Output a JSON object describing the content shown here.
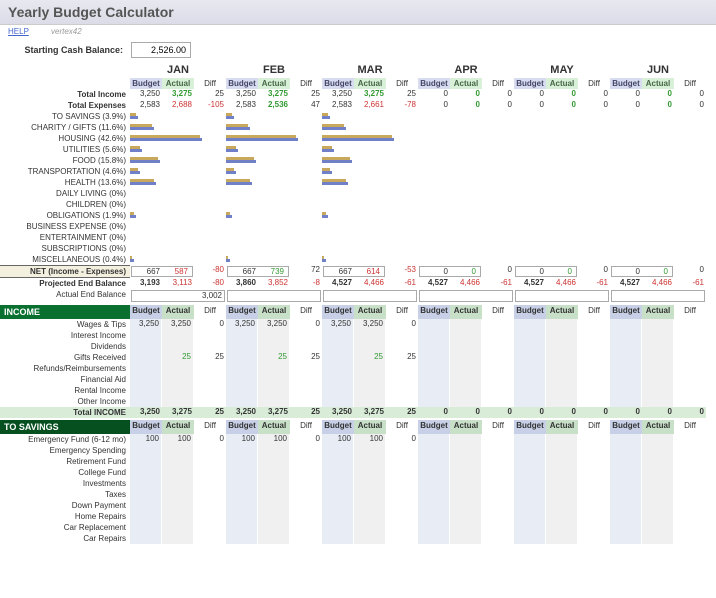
{
  "title": "Yearly Budget Calculator",
  "help": "HELP",
  "brand": "vertex42",
  "start_label": "Starting Cash Balance:",
  "start_value": "2,526.00",
  "months": [
    "JAN",
    "FEB",
    "MAR",
    "APR",
    "MAY",
    "JUN"
  ],
  "subheaders": {
    "budget": "Budget",
    "actual": "Actual",
    "diff": "Diff"
  },
  "summary": {
    "total_income": {
      "label": "Total Income",
      "vals": [
        [
          "3,250",
          "3,275",
          "25"
        ],
        [
          "3,250",
          "3,275",
          "25"
        ],
        [
          "3,250",
          "3,275",
          "25"
        ],
        [
          "0",
          "0",
          "0"
        ],
        [
          "0",
          "0",
          "0"
        ],
        [
          "0",
          "0",
          "0"
        ]
      ]
    },
    "total_expenses": {
      "label": "Total Expenses",
      "vals": [
        [
          "2,583",
          "2,688",
          "-105"
        ],
        [
          "2,583",
          "2,536",
          "47"
        ],
        [
          "2,583",
          "2,661",
          "-78"
        ],
        [
          "0",
          "0",
          "0"
        ],
        [
          "0",
          "0",
          "0"
        ],
        [
          "0",
          "0",
          "0"
        ]
      ]
    }
  },
  "categories": [
    {
      "label": "TO SAVINGS (3.9%)",
      "b": [
        6,
        6,
        6,
        0,
        0,
        0
      ]
    },
    {
      "label": "CHARITY / GIFTS (11.6%)",
      "b": [
        22,
        22,
        22,
        0,
        0,
        0
      ]
    },
    {
      "label": "HOUSING (42.6%)",
      "b": [
        70,
        70,
        70,
        0,
        0,
        0
      ]
    },
    {
      "label": "UTILITIES (5.6%)",
      "b": [
        10,
        10,
        10,
        0,
        0,
        0
      ]
    },
    {
      "label": "FOOD (15.8%)",
      "b": [
        28,
        28,
        28,
        0,
        0,
        0
      ]
    },
    {
      "label": "TRANSPORTATION (4.6%)",
      "b": [
        8,
        8,
        8,
        0,
        0,
        0
      ]
    },
    {
      "label": "HEALTH (13.6%)",
      "b": [
        24,
        24,
        24,
        0,
        0,
        0
      ]
    },
    {
      "label": "DAILY LIVING (0%)",
      "b": [
        0,
        0,
        0,
        0,
        0,
        0
      ]
    },
    {
      "label": "CHILDREN (0%)",
      "b": [
        0,
        0,
        0,
        0,
        0,
        0
      ]
    },
    {
      "label": "OBLIGATIONS (1.9%)",
      "b": [
        4,
        4,
        4,
        0,
        0,
        0
      ]
    },
    {
      "label": "BUSINESS EXPENSE (0%)",
      "b": [
        0,
        0,
        0,
        0,
        0,
        0
      ]
    },
    {
      "label": "ENTERTAINMENT (0%)",
      "b": [
        0,
        0,
        0,
        0,
        0,
        0
      ]
    },
    {
      "label": "SUBSCRIPTIONS (0%)",
      "b": [
        0,
        0,
        0,
        0,
        0,
        0
      ]
    },
    {
      "label": "MISCELLANEOUS (0.4%)",
      "b": [
        2,
        2,
        2,
        0,
        0,
        0
      ]
    }
  ],
  "net": {
    "label": "NET (Income - Expenses)",
    "vals": [
      [
        "667",
        "587",
        "-80"
      ],
      [
        "667",
        "739",
        "72"
      ],
      [
        "667",
        "614",
        "-53"
      ],
      [
        "0",
        "0",
        "0"
      ],
      [
        "0",
        "0",
        "0"
      ],
      [
        "0",
        "0",
        "0"
      ]
    ]
  },
  "projected": {
    "label": "Projected End Balance",
    "vals": [
      [
        "3,193",
        "3,113",
        "-80"
      ],
      [
        "3,860",
        "3,852",
        "-8"
      ],
      [
        "4,527",
        "4,466",
        "-61"
      ],
      [
        "4,527",
        "4,466",
        "-61"
      ],
      [
        "4,527",
        "4,466",
        "-61"
      ],
      [
        "4,527",
        "4,466",
        "-61"
      ]
    ]
  },
  "actual_end": {
    "label": "Actual End Balance",
    "val": "3,002"
  },
  "income_section": {
    "title": "INCOME",
    "rows": [
      "Wages & Tips",
      "Interest Income",
      "Dividends",
      "Gifts Received",
      "Refunds/Reimbursements",
      "Financial Aid",
      "Rental Income",
      "Other Income"
    ],
    "data": {
      "0": {
        "budget": [
          3250,
          3250,
          3250,
          null,
          null,
          null
        ],
        "actual": [
          3250,
          3250,
          3250,
          null,
          null,
          null
        ]
      },
      "3": {
        "budget": [
          null,
          null,
          null,
          null,
          null,
          null
        ],
        "actual": [
          25,
          25,
          25,
          null,
          null,
          null
        ]
      }
    },
    "total": {
      "label": "Total INCOME",
      "vals": [
        [
          "3,250",
          "3,275",
          "25"
        ],
        [
          "3,250",
          "3,275",
          "25"
        ],
        [
          "3,250",
          "3,275",
          "25"
        ],
        [
          "0",
          "0",
          "0"
        ],
        [
          "0",
          "0",
          "0"
        ],
        [
          "0",
          "0",
          "0"
        ]
      ]
    }
  },
  "savings_section": {
    "title": "TO SAVINGS",
    "rows": [
      "Emergency Fund (6-12 mo)",
      "Emergency Spending",
      "Retirement Fund",
      "College Fund",
      "Investments",
      "Taxes",
      "Down Payment",
      "Home Repairs",
      "Car Replacement",
      "Car Repairs"
    ],
    "data": {
      "0": {
        "budget": [
          100,
          100,
          100,
          null,
          null,
          null
        ],
        "actual": [
          100,
          100,
          100,
          null,
          null,
          null
        ]
      }
    }
  }
}
